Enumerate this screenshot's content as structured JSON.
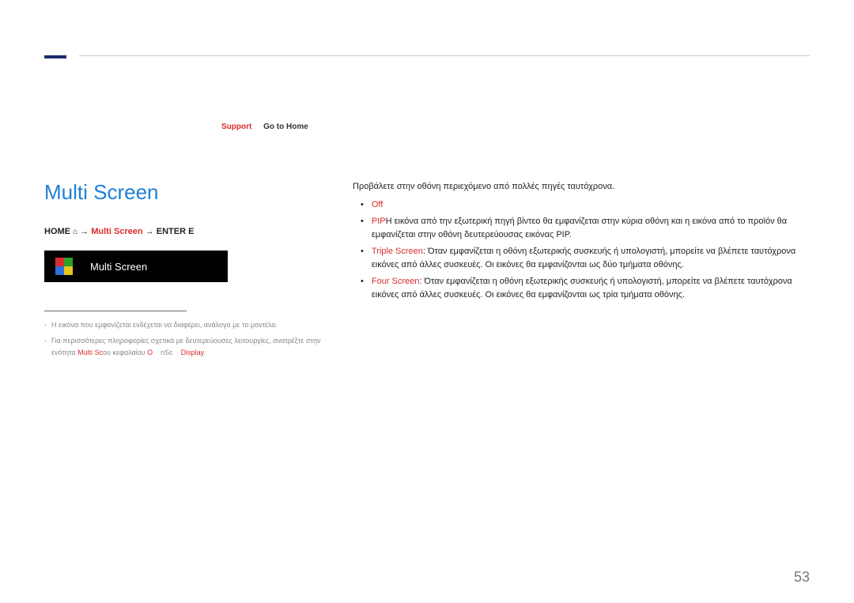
{
  "nav": {
    "support": "Support",
    "home": "Go to Home"
  },
  "title": "Multi Screen",
  "path": {
    "home": "HOME",
    "house": "⌂",
    "arrow": "→",
    "multi": "Multi Screen",
    "enter": "ENTER",
    "enterGlyph": "E"
  },
  "bar": {
    "label": "Multi Screen"
  },
  "footnotes": {
    "a": "Η εικόνα που εμφανίζεται ενδέχεται να διαφέρει, ανάλογα με το μοντέλο.",
    "b_before": "Για περισσότερες πληροφορίες σχετικά με δευτερεύουσες λειτουργίες, ανατρέξτε στην ενότητα ",
    "b_red1": "Multi Sc",
    "b_mid1": "ου κεφαλαίου ",
    "b_red2": "O",
    "b_mid2": "nSc",
    "b_red3": "Display",
    "b_end": "."
  },
  "intro": "Προβάλετε στην οθόνη περιεχόμενο από πολλές πηγές ταυτόχρονα.",
  "items": {
    "off": {
      "label": "Off",
      "text": ""
    },
    "pip": {
      "label": "PIP",
      "text": "Η εικόνα από την εξωτερική πηγή βίντεο θα εμφανίζεται στην κύρια οθόνη και η εικόνα από το προϊόν θα εμφανίζεται στην οθόνη δευτερεύουσας εικόνας PIP."
    },
    "triple": {
      "label": "Triple Screen",
      "text": ": Όταν εμφανίζεται η οθόνη εξωτερικής συσκευής ή υπολογιστή, μπορείτε να βλέπετε ταυτόχρονα εικόνες από άλλες συσκευές. Οι εικόνες θα εμφανίζονται ως δύο τμήματα οθόνης."
    },
    "four": {
      "label": "Four Screen",
      "text": ": Όταν εμφανίζεται η οθόνη εξωτερικής συσκευής ή υπολογιστή, μπορείτε να βλέπετε ταυτόχρονα εικόνες από άλλες συσκευές. Οι εικόνες θα εμφανίζονται ως τρία τμήματα οθόνης."
    }
  },
  "pageNumber": "53"
}
